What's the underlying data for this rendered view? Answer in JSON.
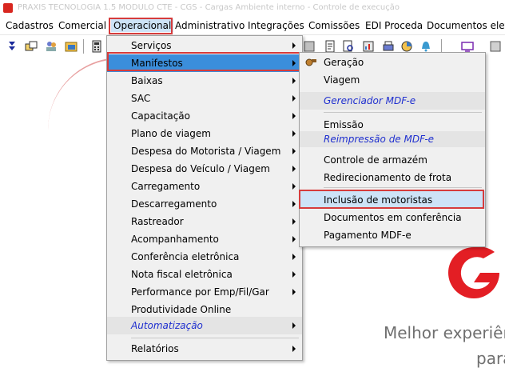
{
  "window": {
    "title": "PRAXIS TECNOLOGIA 1.5 MODULO CTE - CGS - Cargas          Ambiente interno - Controle de execução"
  },
  "menubar": {
    "items": [
      "Cadastros",
      "Comercial",
      "Operacional",
      "Administrativo",
      "Integrações",
      "Comissões",
      "EDI Proceda",
      "Documentos eletr"
    ]
  },
  "menu_operacional": {
    "items": [
      {
        "label": "Serviços",
        "submenu": true
      },
      {
        "label": "Manifestos",
        "submenu": true
      },
      {
        "label": "Baixas",
        "submenu": true
      },
      {
        "label": "SAC",
        "submenu": true
      },
      {
        "label": "Capacitação",
        "submenu": true
      },
      {
        "label": "Plano de viagem",
        "submenu": true
      },
      {
        "label": "Despesa do Motorista / Viagem",
        "submenu": true
      },
      {
        "label": "Despesa do Veículo / Viagem",
        "submenu": true
      },
      {
        "label": "Carregamento",
        "submenu": true
      },
      {
        "label": "Descarregamento",
        "submenu": true
      },
      {
        "label": "Rastreador",
        "submenu": true
      },
      {
        "label": "Acompanhamento",
        "submenu": true
      },
      {
        "label": "Conferência eletrônica",
        "submenu": true
      },
      {
        "label": "Nota fiscal eletrônica",
        "submenu": true
      },
      {
        "label": "Performance por Emp/Fil/Gar",
        "submenu": true
      },
      {
        "label": "Produtividade Online",
        "submenu": false
      },
      {
        "label": "Automatização",
        "submenu": true
      },
      {
        "label": "Relatórios",
        "submenu": true
      }
    ]
  },
  "menu_manifestos": {
    "items": [
      {
        "label": "Geração"
      },
      {
        "label": "Viagem"
      },
      {
        "label": "Gerenciador MDF-e"
      },
      {
        "label": "Emissão"
      },
      {
        "label": "Reimpressão de MDF-e"
      },
      {
        "label": "Controle de armazém"
      },
      {
        "label": "Redirecionamento de frota"
      },
      {
        "label": "Inclusão de motoristas"
      },
      {
        "label": "Documentos em conferência"
      },
      {
        "label": "Pagamento MDF-e"
      }
    ]
  },
  "brand": {
    "tagline_line1": "Melhor experiên",
    "tagline_line2": "para",
    "accent_color": "#e31e24"
  },
  "highlight_color": "#d63c3c",
  "selection_color": "#3b8edb"
}
